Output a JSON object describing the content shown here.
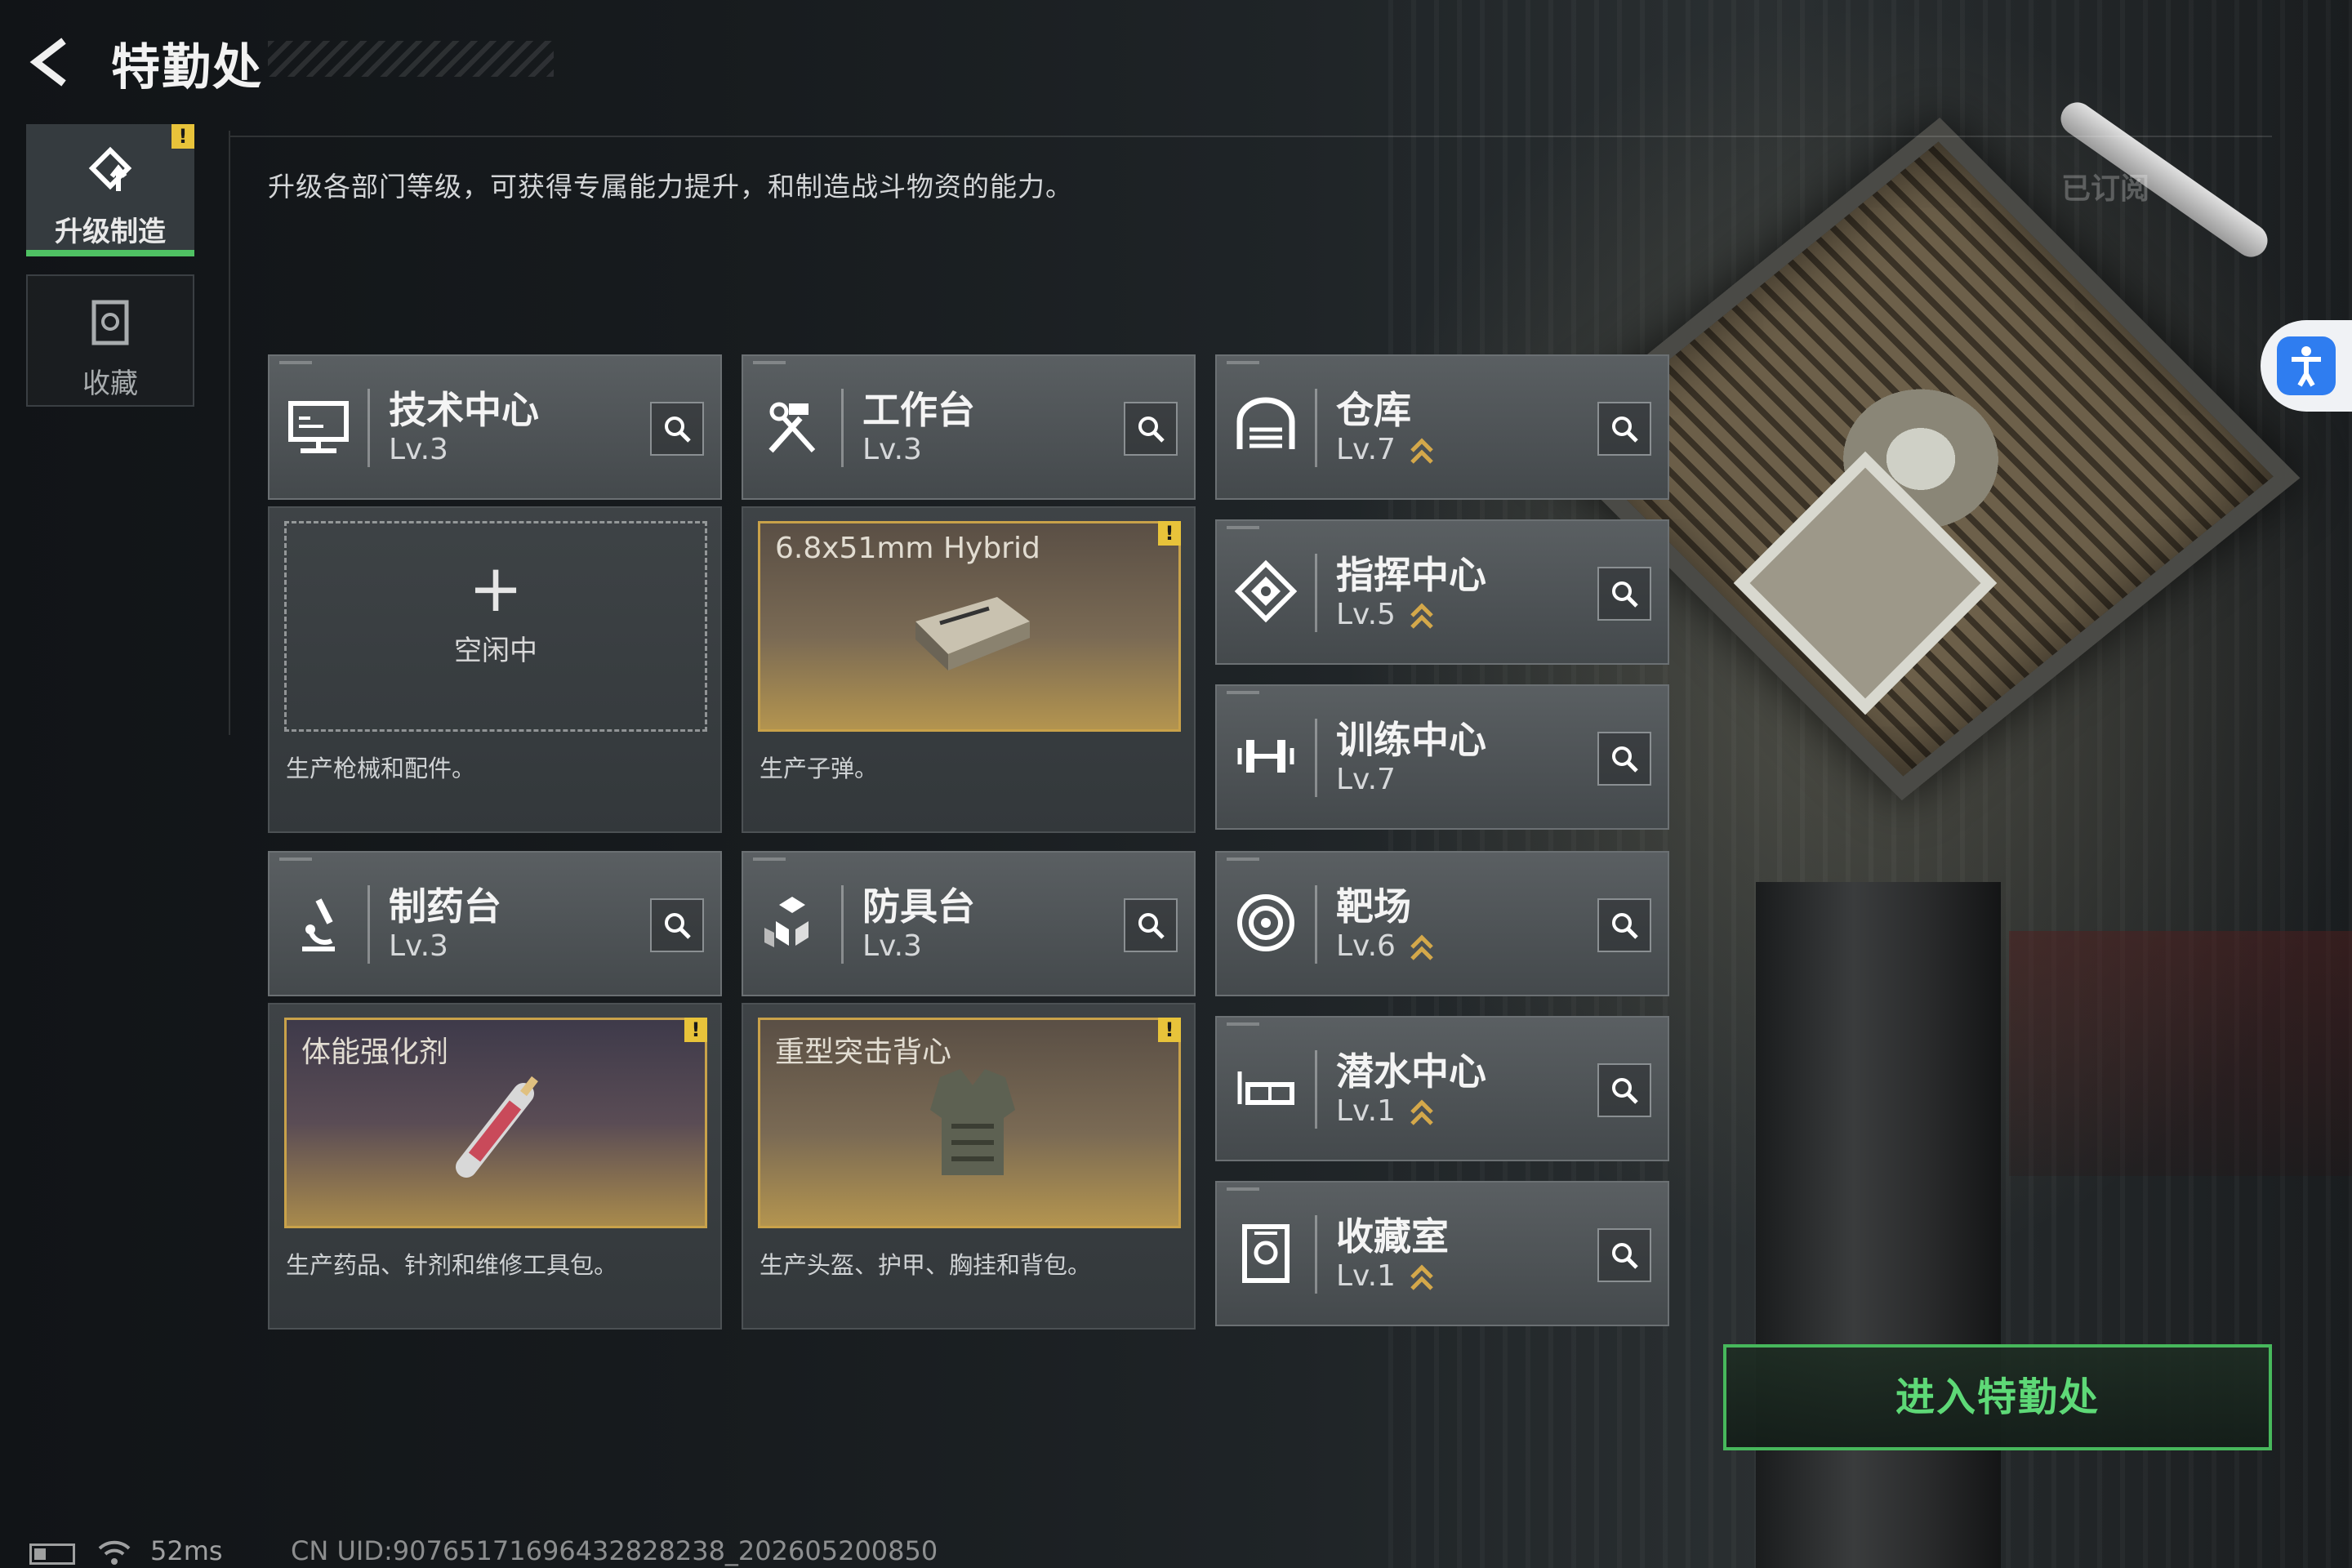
{
  "header": {
    "title": "特勤处"
  },
  "tabs": [
    {
      "label": "升级制造",
      "active": true,
      "alert": "!"
    },
    {
      "label": "收藏",
      "active": false
    }
  ],
  "subtitle": "升级各部门等级，可获得专属能力提升，和制造战斗物资的能力。",
  "subscribed_label": "已订阅",
  "departments": {
    "tech": {
      "name": "技术中心",
      "level": "Lv.3",
      "icon": "monitor-icon"
    },
    "workbench": {
      "name": "工作台",
      "level": "Lv.3",
      "icon": "hammer-wrench-icon"
    },
    "warehouse": {
      "name": "仓库",
      "level": "Lv.7",
      "icon": "garage-icon",
      "upgradable": true
    },
    "command": {
      "name": "指挥中心",
      "level": "Lv.5",
      "icon": "command-emblem-icon",
      "upgradable": true
    },
    "training": {
      "name": "训练中心",
      "level": "Lv.7",
      "icon": "dumbbell-icon"
    },
    "pharmacy": {
      "name": "制药台",
      "level": "Lv.3",
      "icon": "microscope-icon"
    },
    "armor": {
      "name": "防具台",
      "level": "Lv.3",
      "icon": "armor-blocks-icon"
    },
    "range": {
      "name": "靶场",
      "level": "Lv.6",
      "icon": "target-icon",
      "upgradable": true
    },
    "diving": {
      "name": "潜水中心",
      "level": "Lv.1",
      "icon": "diving-goggles-icon",
      "upgradable": true
    },
    "collection": {
      "name": "收藏室",
      "level": "Lv.1",
      "icon": "vault-icon",
      "upgradable": true
    }
  },
  "production": {
    "tech": {
      "state": "空闲中",
      "plus": "+",
      "desc": "生产枪械和配件。"
    },
    "workbench": {
      "item": "6.8x51mm Hybrid",
      "desc": "生产子弹。",
      "alert": "!"
    },
    "pharmacy": {
      "item": "体能强化剂",
      "desc": "生产药品、针剂和维修工具包。",
      "alert": "!"
    },
    "armor": {
      "item": "重型突击背心",
      "desc": "生产头盔、护甲、胸挂和背包。",
      "alert": "!"
    }
  },
  "enter_button": "进入特勤处",
  "status": {
    "ping": "52ms",
    "uid": "CN UID:9076517169643282823​8_202605200850"
  },
  "colors": {
    "accent_green": "#4fc163",
    "alert_yellow": "#e8c33a",
    "upgrade_gold": "#d4a84a"
  }
}
